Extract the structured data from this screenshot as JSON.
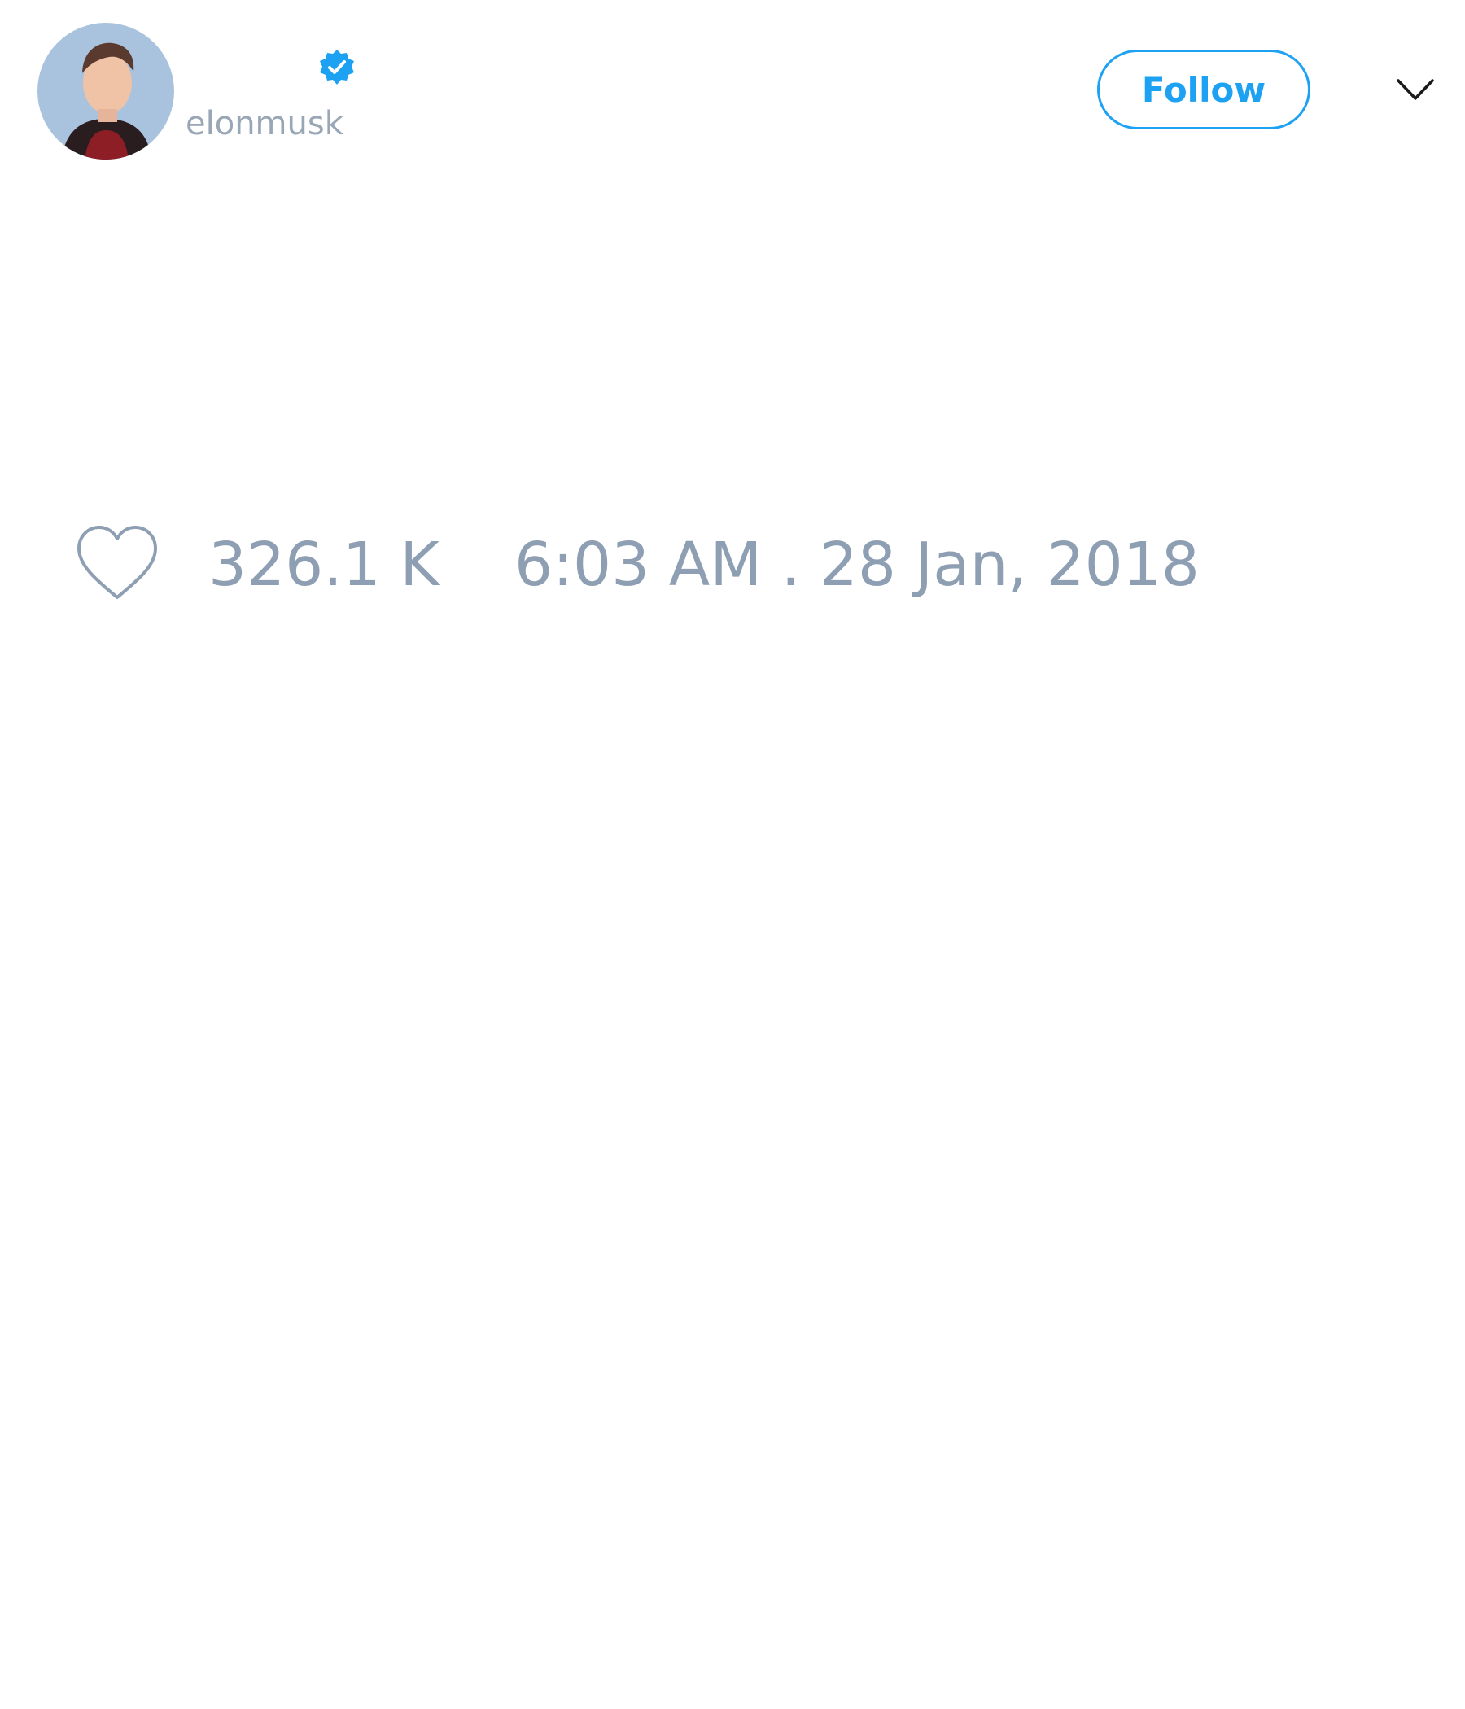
{
  "author": {
    "handle": "elonmusk",
    "verified": true,
    "avatar_icon": "profile-photo",
    "verified_icon": "verified-badge-icon"
  },
  "header": {
    "follow_label": "Follow",
    "menu_icon": "chevron-down-icon"
  },
  "tweet": {
    "like_icon": "heart-icon",
    "like_count": "326.1 K",
    "timestamp": "6:03 AM . 28 Jan, 2018"
  },
  "colors": {
    "accent": "#1da1f2",
    "muted_text": "#8f9fb3",
    "background": "#ffffff"
  }
}
